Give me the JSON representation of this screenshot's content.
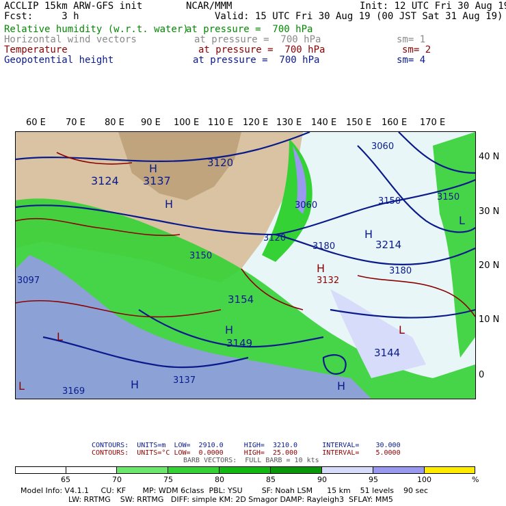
{
  "header": {
    "title": "ACCLIP 15km ARW-GFS init",
    "fcst": "Fcst:     3 h",
    "org": "NCAR/MMM",
    "init": "Init: 12 UTC Fri 30 Aug 19",
    "valid": "Valid: 15 UTC Fri 30 Aug 19 (00 JST Sat 31 Aug 19)"
  },
  "fields": [
    {
      "name": "Relative humidity (w.r.t. water)",
      "level": "at pressure =  700 hPa",
      "sm": "",
      "color": "#008a00"
    },
    {
      "name": "Horizontal wind vectors",
      "level": "at pressure =  700 hPa",
      "sm": "sm= 1",
      "color": "#8a8a8a"
    },
    {
      "name": "Temperature",
      "level": "at pressure =  700 hPa",
      "sm": "sm= 2",
      "color": "#8b0000"
    },
    {
      "name": "Geopotential height",
      "level": "at pressure =  700 hPa",
      "sm": "sm= 4",
      "color": "#0a1a8a"
    }
  ],
  "map": {
    "lon_labels": [
      "60 E",
      "70 E",
      "80 E",
      "90 E",
      "100 E",
      "110 E",
      "120 E",
      "130 E",
      "140 E",
      "150 E",
      "160 E",
      "170 E"
    ],
    "lat_labels": [
      "40 N",
      "30 N",
      "20 N",
      "10 N",
      "0"
    ],
    "height_labels": [
      "3120",
      "3124",
      "3137",
      "3060",
      "3060",
      "3150",
      "3150",
      "3180",
      "3214",
      "3180",
      "3120",
      "3150",
      "3149",
      "3144",
      "3137",
      "3169",
      "3097",
      "3132",
      "3154"
    ],
    "highs_lows": [
      "H",
      "H",
      "H",
      "L",
      "H",
      "L",
      "H",
      "H",
      "L",
      "H",
      "L"
    ]
  },
  "contours": {
    "line1": {
      "label": "CONTOURS:",
      "units": "UNITS=m",
      "low": "LOW=  2910.0",
      "high": "HIGH=  3210.0",
      "interval": "INTERVAL=    30.000"
    },
    "line2": {
      "label": "CONTOURS:",
      "units": "UNITS=°C",
      "low": "LOW=  0.0000",
      "high": "HIGH=  25.000",
      "interval": "INTERVAL=    5.0000"
    },
    "barb": "BARB VECTORS:  FULL BARB = 10 kts"
  },
  "colorbar": {
    "ticks": [
      "65",
      "70",
      "75",
      "80",
      "85",
      "90",
      "95",
      "100"
    ],
    "unit": "%",
    "colors": [
      "#ffffff",
      "#ffffff",
      "#6be86b",
      "#34d234",
      "#12b812",
      "#0a960a",
      "#d6dcfa",
      "#9999f0",
      "#ffeb00"
    ]
  },
  "model_info": {
    "line1": "Model Info: V4.1.1     CU: KF       MP: WDM 6class  PBL: YSU        SF: Noah LSM      15 km    51 levels    90 sec",
    "line2": "LW: RRTMG    SW: RRTMG   DIFF: simple KM: 2D Smagor DAMP: Rayleigh3  SFLAY: MM5"
  }
}
